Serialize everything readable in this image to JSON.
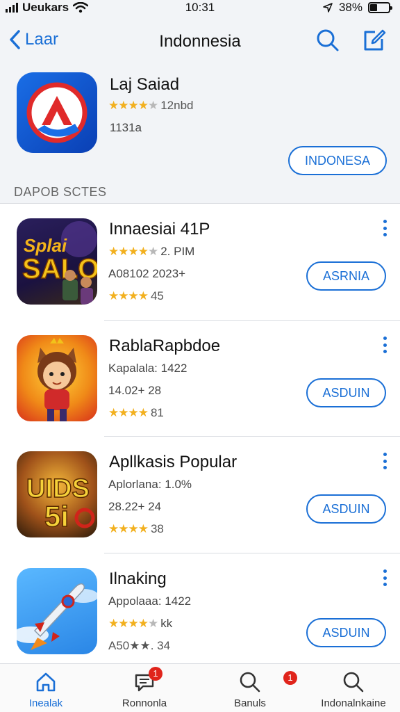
{
  "status_bar": {
    "carrier": "Ueukars",
    "time": "10:31",
    "battery": "38%",
    "battery_level": 0.38
  },
  "nav": {
    "back_label": "Laar",
    "title": "Indonnesia",
    "icons": [
      "search-icon",
      "compose-icon"
    ]
  },
  "featured": {
    "title": "Laj Saiad",
    "rating_stars": 4.5,
    "rating_text": "12nbd",
    "count": "1131a",
    "button_label": "INDONESA"
  },
  "section_header": "DAPOB SCTES",
  "apps": [
    {
      "title": "Innaesiai 41P",
      "meta1_text": "2. PIM",
      "meta1_stars": 4.5,
      "meta2": "A08102  2023+",
      "rating_stars": 4,
      "rating_text": "45",
      "button_label": "ASRNIA",
      "icon_text": "Splai SALO"
    },
    {
      "title": "RablaRapbdoe",
      "meta1_text": "Kapalala: 1422",
      "meta1_stars": 0,
      "meta2": "14.02+  28",
      "rating_stars": 4,
      "rating_text": "81",
      "button_label": "ASDUIN",
      "icon_text": ""
    },
    {
      "title": "Apllkasis Popular",
      "meta1_text": "Aplorlana: 1.0%",
      "meta1_stars": 0,
      "meta2": "28.22+  24",
      "rating_stars": 4,
      "rating_text": "38",
      "button_label": "ASDUIN",
      "icon_text": "UIDS 5io"
    },
    {
      "title": "Ilnaking",
      "meta1_text": "Appolaaa: 1422",
      "meta1_stars": 4.5,
      "meta2_suffix": "kk",
      "meta2": "A50★★.  34",
      "rating_stars": 0,
      "rating_text": "",
      "button_label": "ASDUIN",
      "icon_text": ""
    }
  ],
  "tab_bar": {
    "tabs": [
      {
        "label": "Inealak",
        "icon": "home-icon",
        "active": true,
        "badge": ""
      },
      {
        "label": "Ronnonla",
        "icon": "chat-icon",
        "active": false,
        "badge": "1"
      },
      {
        "label": "Banuls",
        "icon": "search-icon",
        "active": false,
        "badge": "1"
      },
      {
        "label": "Indonalnkaine",
        "icon": "search-icon",
        "active": false,
        "badge": ""
      }
    ]
  },
  "colors": {
    "accent": "#1a6fd6",
    "star": "#f2b01e",
    "badge": "#e0241b",
    "header_bg": "#f2f4f7"
  }
}
